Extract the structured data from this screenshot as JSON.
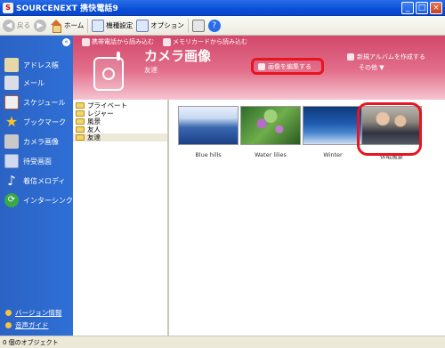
{
  "window": {
    "title": "SOURCENEXT 携快電話9"
  },
  "toolbar": {
    "back": "戻る",
    "home": "ホーム",
    "model_settings": "機種設定",
    "options": "オプション"
  },
  "sidebar": {
    "items": [
      {
        "label": "アドレス帳",
        "icon": "address-book-icon"
      },
      {
        "label": "メール",
        "icon": "mail-icon"
      },
      {
        "label": "スケジュール",
        "icon": "schedule-icon"
      },
      {
        "label": "ブックマーク",
        "icon": "bookmark-star-icon"
      },
      {
        "label": "カメラ画像",
        "icon": "camera-icon"
      },
      {
        "label": "待受画面",
        "icon": "wallpaper-icon"
      },
      {
        "label": "着信メロディ",
        "icon": "music-note-icon"
      },
      {
        "label": "インターシンク",
        "icon": "sync-icon"
      }
    ],
    "footer": [
      {
        "label": "バージョン情報"
      },
      {
        "label": "音声ガイド"
      }
    ]
  },
  "banner": {
    "title": "カメラ画像",
    "subtitle": "友達",
    "read_from_phone": "携帯電話から読み込む",
    "read_from_card": "メモリカードから読み込む",
    "edit_image": "画像を編集する",
    "new_album": "新規アルバムを作成する",
    "other": "その他 ▼"
  },
  "folders": [
    {
      "label": "プライベート",
      "selected": false
    },
    {
      "label": "レジャー",
      "selected": false
    },
    {
      "label": "風景",
      "selected": false
    },
    {
      "label": "友人",
      "selected": false
    },
    {
      "label": "友達",
      "selected": true
    }
  ],
  "thumbnails": [
    {
      "caption": "Blue hills"
    },
    {
      "caption": "Water lilies"
    },
    {
      "caption": "Winter"
    },
    {
      "caption": "休暇風景"
    }
  ],
  "status": {
    "text": "0 個のオブジェクト"
  },
  "colors": {
    "banner": "#d2476b",
    "nav": "#2f6fd6",
    "highlight": "#e8141f"
  }
}
